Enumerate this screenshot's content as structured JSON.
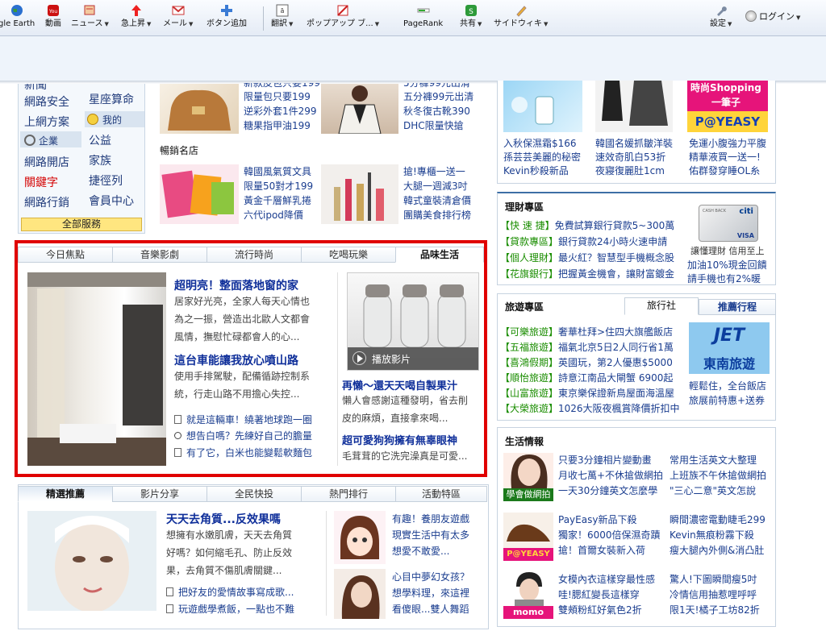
{
  "toolbar": {
    "items": [
      {
        "label": "gle Earth",
        "icon": "earth-icon"
      },
      {
        "label": "動画",
        "icon": "youtube-icon"
      },
      {
        "label": "ニュース",
        "icon": "news-icon"
      },
      {
        "label": "急上昇",
        "icon": "trend-up-icon"
      },
      {
        "label": "メール",
        "icon": "gmail-icon"
      },
      {
        "label": "ボタン追加",
        "icon": "plus-icon"
      },
      {
        "label": "翻訳",
        "icon": "translate-icon"
      },
      {
        "label": "ポップアップ ブ...",
        "icon": "popup-block-icon"
      },
      {
        "label": "PageRank",
        "icon": "pagerank-icon"
      },
      {
        "label": "共有",
        "icon": "share-icon"
      },
      {
        "label": "サイドウィキ",
        "icon": "sidewiki-icon"
      },
      {
        "label": "設定",
        "icon": "wrench-icon"
      },
      {
        "label": "ログイン",
        "icon": "login-icon"
      }
    ]
  },
  "services": {
    "col1": [
      "網路安全",
      "上網方案",
      "企業",
      "網路開店",
      "關鍵字",
      "網路行銷"
    ],
    "col2": [
      "星座算命",
      "我的",
      "公益",
      "家族",
      "捷徑列",
      "會員中心"
    ],
    "all_label": "全部服務",
    "top_partial": "新聞"
  },
  "shop_top": {
    "item1": [
      "限量包只要199",
      "逆彩外套1件299",
      "糖果指甲油199"
    ],
    "item1_top": "新款皮包只要199",
    "item2": [
      "五分褲99元出清",
      "秋冬復古靴390",
      "DHC限量快搶"
    ],
    "item2_top": "5分褲99元出清"
  },
  "bestsellers": {
    "title": "暢銷名店",
    "item1": [
      "韓國風氣質文具",
      "限量50對才199",
      "黃金千層鮮乳捲",
      "六代ipod降價"
    ],
    "item2": [
      "搶!專櫃一送一",
      "大腿一週減3吋",
      "韓式童裝清倉價",
      "團購美食排行榜"
    ]
  },
  "lifestyle": {
    "tabs": [
      "今日焦點",
      "音樂影劇",
      "流行時尚",
      "吃喝玩樂",
      "品味生活"
    ],
    "active_tab": 4,
    "story1": {
      "title": "超明亮！整面落地窗的家",
      "body": [
        "居家好光亮，全家人每天心情也",
        "為之一振，營造出北歐人文都會",
        "風情，撫慰忙碌都會人的心..."
      ]
    },
    "story2": {
      "title": "這台車能讓我放心噴山路",
      "body": [
        "使用手排駕駛，配備循跡控制系",
        "統，行走山路不用擔心失控..."
      ]
    },
    "links": [
      "就是這輛車！繞著地球跑一圈",
      "想告白嗎？先練好自己的膽量",
      "有了它，白米也能變鬆軟麵包"
    ],
    "video_label": "播放影片",
    "story3": {
      "title": "再懶～還天天喝自製果汁",
      "body": [
        "懶人會感謝這種發明，省去削",
        "皮的麻煩，直接拿來喝..."
      ]
    },
    "story4": {
      "title": "超可愛狗狗擁有無辜眼神",
      "body": [
        "毛茸茸的它洗完澡真是可愛..."
      ]
    }
  },
  "featured": {
    "tabs": [
      "精選推薦",
      "影片分享",
      "全民快投",
      "熱門排行",
      "活動特區"
    ],
    "active_tab": 0,
    "story1": {
      "title": "天天去角質...反效果嗎",
      "body": [
        "想擁有水嫩肌膚，天天去角質",
        "好嗎？如何縮毛孔、防止反效",
        "果，去角質不傷肌膚關鍵..."
      ]
    },
    "links": [
      "把好友的愛情故事寫成歌...",
      "玩遊戲學煮飯，一點也不難"
    ],
    "story2": [
      "有趣！養朋友遊戲",
      "現實生活中有太多",
      "想愛不敢愛..."
    ],
    "story3": [
      "心目中夢幻女孩？",
      "想學料理，來這裡",
      "看傻眼...雙人舞蹈"
    ]
  },
  "right_top": {
    "col1": [
      "入秋保濕霜$166",
      "孫芸芸美麗的秘密",
      "Kevin秒殺新品"
    ],
    "col2": [
      "韓國名媛抓皺洋裝",
      "速效奇肌白53折",
      "夜寢復麗肚1cm"
    ],
    "col3": [
      "免運小腹強力平腹",
      "精華液買一送一!",
      "佑群發穿睡OL糸"
    ],
    "banner": "時尚Shopping",
    "banner2": "一筆子"
  },
  "finance": {
    "title": "理財專區",
    "rows": [
      {
        "tag": "【快 速 捷】",
        "text": "免費試算銀行貸款5~300萬"
      },
      {
        "tag": "【貸款專區】",
        "text": "銀行貸款24小時火速申請"
      },
      {
        "tag": "【個人理財】",
        "text": "最火紅？智慧型手機概念股"
      },
      {
        "tag": "【花旗銀行】",
        "text": "把握黃金機會，讓財富鍍金"
      }
    ],
    "side": [
      "讓懂理財 信用至上",
      "加油10%現金回饋",
      "請手機也有2%暖"
    ],
    "card_brand": "citi",
    "card_text": "CASH BACK",
    "card_network": "VISA"
  },
  "travel": {
    "title": "旅遊專區",
    "tabs": [
      "旅行社",
      "推薦行程"
    ],
    "rows": [
      {
        "tag": "【可樂旅遊】",
        "text": "奢華杜拜>住四大旗艦飯店"
      },
      {
        "tag": "【五福旅遊】",
        "text": "福氣北京5日2人同行省1萬"
      },
      {
        "tag": "【喜鴻假期】",
        "text": "英國玩，第2人優惠$5000"
      },
      {
        "tag": "【順怡旅遊】",
        "text": "詩意江南品大閘蟹 6900起"
      },
      {
        "tag": "【山富旅遊】",
        "text": "東京樂保證新鳥屋面海溫屋"
      },
      {
        "tag": "【大榮旅遊】",
        "text": "1026大阪夜楓賞降價折扣中"
      }
    ],
    "side": [
      "東南旅遊",
      "輕鬆住，全台飯店",
      "旅展前特惠+送券"
    ],
    "logo": "JET"
  },
  "life": {
    "title": "生活情報",
    "rows": [
      {
        "img": "學會做網拍",
        "a": [
          "只要3分鐘相片變動畫",
          "月收七萬+不休搶做網拍",
          "一天30分鐘英文怎麼學"
        ],
        "b": [
          "常用生活英文大整理",
          "上班族不午休搶做網拍",
          "\"三心二意\"英文怎說"
        ]
      },
      {
        "img": "P@YEASY",
        "a": [
          "PayEasy新品下殺",
          "獨家！6000倍保濕奇蹟",
          "搶！首爾女裝新入荷"
        ],
        "b": [
          "瞬間濃密電動睫毛299",
          "Kevin無痕粉霧下殺",
          "瘦大腿內外側&消凸肚"
        ]
      },
      {
        "img": "momo",
        "a": [
          "女模內衣這樣穿最性感",
          "哇!腮紅變長這樣穿",
          "雙頰粉紅好氣色2折"
        ],
        "b": [
          "驚人!下圖瞬間瘦5吋",
          "冷情信用抽惹哩呼呼",
          "限1天!橘子工坊82折"
        ]
      }
    ]
  }
}
